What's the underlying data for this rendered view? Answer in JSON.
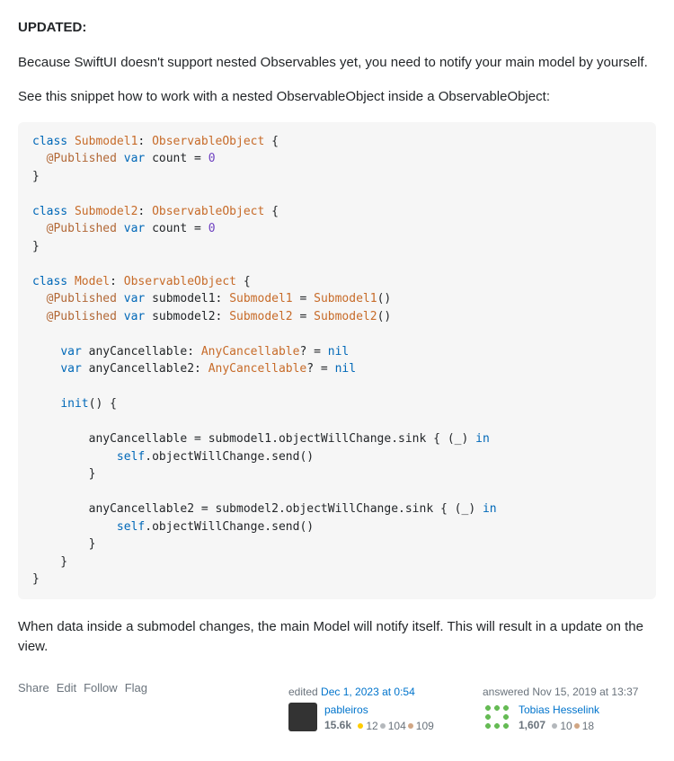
{
  "post": {
    "updated_label": "UPDATED:",
    "para1": "Because SwiftUI doesn't support nested Observables yet, you need to notify your main model by yourself.",
    "para2": "See this snippet how to work with a nested ObservableObject inside a ObservableObject:",
    "para3": "When data inside a submodel changes, the main Model will notify itself. This will result in a update on the view."
  },
  "actions": {
    "share": "Share",
    "edit": "Edit",
    "follow": "Follow",
    "flag": "Flag"
  },
  "editor": {
    "action": "edited ",
    "time": "Dec 1, 2023 at 0:54",
    "name": "pableiros",
    "rep": "15.6k",
    "gold": "12",
    "silver": "104",
    "bronze": "109"
  },
  "author": {
    "action": "answered ",
    "time": "Nov 15, 2019 at 13:37",
    "name": "Tobias Hesselink",
    "rep": "1,607",
    "silver": "10",
    "bronze": "18"
  },
  "code": {
    "kw_class": "class",
    "kw_var": "var",
    "kw_in": "in",
    "kw_nil": "nil",
    "kw_self": "self",
    "attr_published": "@Published",
    "type_observable": "ObservableObject",
    "type_sub1": "Submodel1",
    "type_sub2": "Submodel2",
    "type_model": "Model",
    "type_anycancel": "AnyCancellable",
    "id_count": "count",
    "id_sub1": "submodel1",
    "id_sub2": "submodel2",
    "id_anyc": "anyCancellable",
    "id_anyc2": "anyCancellable2",
    "id_init": "init",
    "id_owc": "objectWillChange",
    "id_sink": "sink",
    "id_send": "send",
    "num_zero": "0",
    "us": "_"
  }
}
